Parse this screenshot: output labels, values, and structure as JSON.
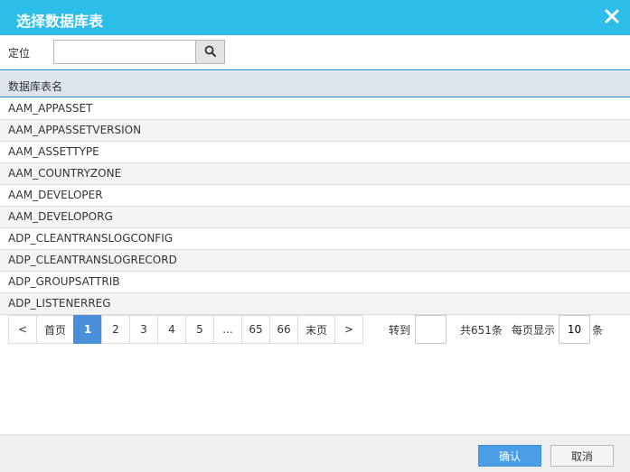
{
  "dialog": {
    "title": "选择数据库表"
  },
  "search": {
    "label": "定位",
    "value": "",
    "placeholder": ""
  },
  "table": {
    "header": "数据库表名",
    "rows": [
      "AAM_APPASSET",
      "AAM_APPASSETVERSION",
      "AAM_ASSETTYPE",
      "AAM_COUNTRYZONE",
      "AAM_DEVELOPER",
      "AAM_DEVELOPORG",
      "ADP_CLEANTRANSLOGCONFIG",
      "ADP_CLEANTRANSLOGRECORD",
      "ADP_GROUPSATTRIB",
      "ADP_LISTENERREG"
    ]
  },
  "pagination": {
    "prev": "<",
    "first": "首页",
    "pages": [
      "1",
      "2",
      "3",
      "4",
      "5",
      "...",
      "65",
      "66"
    ],
    "active_page": "1",
    "last": "末页",
    "next": ">",
    "goto_label": "转到",
    "goto_value": "",
    "total": "共651条",
    "per_page_label": "每页显示",
    "per_page_value": "10",
    "per_page_unit": "条"
  },
  "footer": {
    "confirm": "确认",
    "cancel": "取消"
  },
  "colors": {
    "titlebar": "#2cbde8",
    "active_page": "#4a8fd9",
    "confirm_button": "#4a9ee6"
  }
}
